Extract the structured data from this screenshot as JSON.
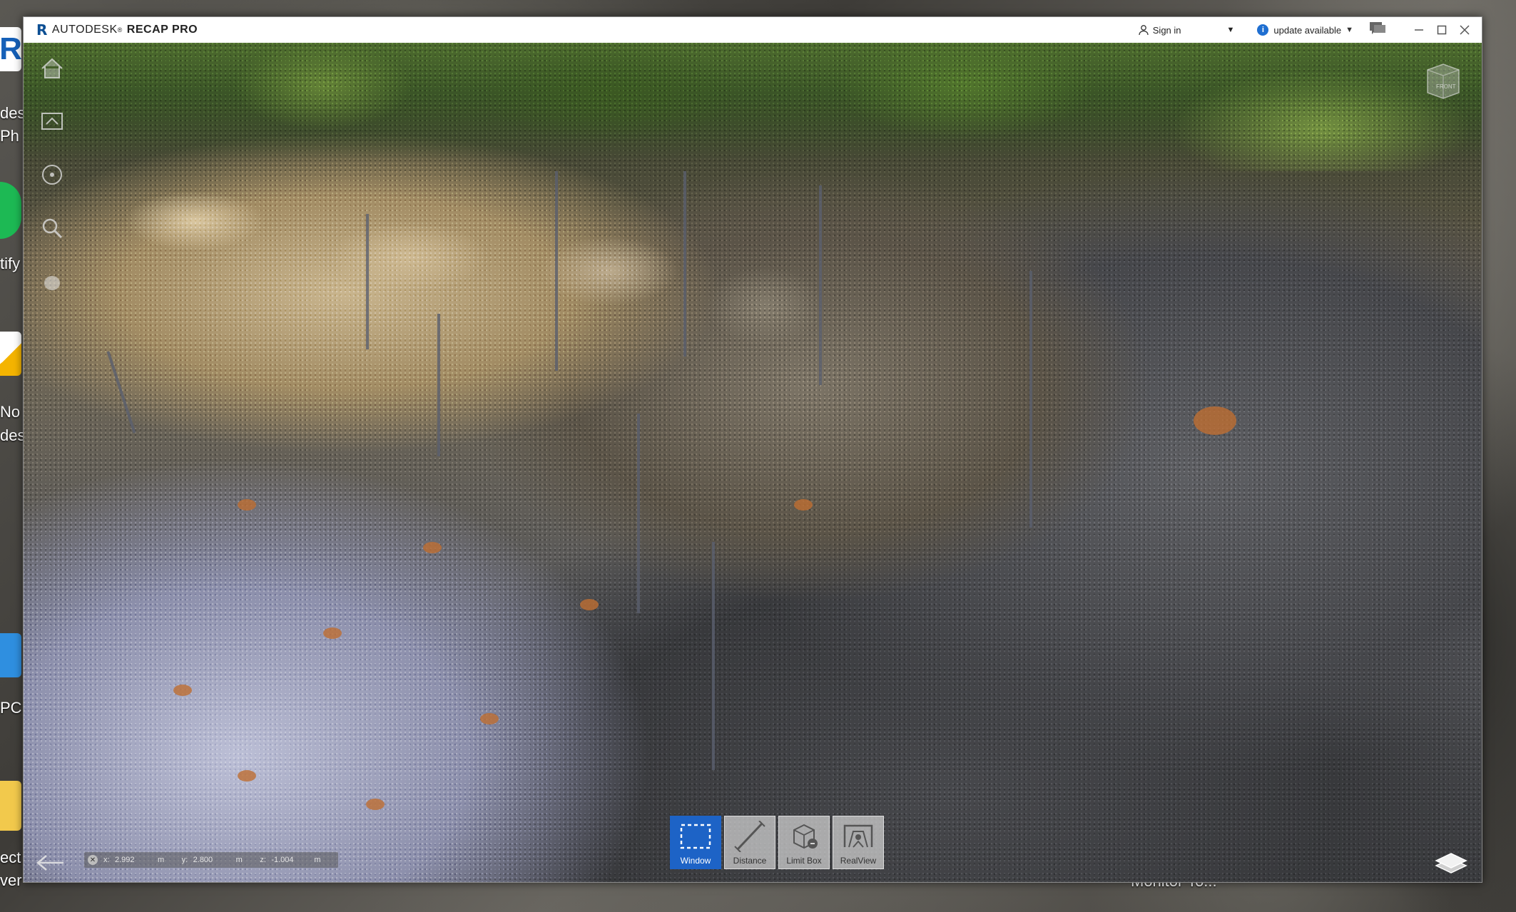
{
  "app": {
    "brand": "AUTODESK",
    "trademark": "®",
    "product": "RECAP PRO",
    "logo_letter": "R"
  },
  "titlebar": {
    "sign_in_label": "Sign in",
    "update_label": "update available",
    "info_glyph": "i"
  },
  "viewcube": {
    "face_label": "FRONT"
  },
  "coordinates": {
    "x_label": "x:",
    "x_value": "2.992",
    "x_unit": "m",
    "y_label": "y:",
    "y_value": "2.800",
    "y_unit": "m",
    "z_label": "z:",
    "z_value": "-1.004",
    "z_unit": "m"
  },
  "toolbar": {
    "window_label": "Window",
    "distance_label": "Distance",
    "limit_box_label": "Limit Box",
    "realview_label": "RealView",
    "active_tool": "Window"
  },
  "desktop": {
    "icon_labels": [
      "des",
      "Ph",
      "tify",
      "No",
      "des",
      "PC",
      "ect",
      "ver"
    ],
    "taskbar_text": "Monitor To..."
  },
  "colors": {
    "accent": "#1d63c6",
    "info": "#1f6fd1",
    "logo": "#0d4f93"
  },
  "icons": {
    "home": "home-icon",
    "zoom_extents": "frame-icon",
    "orbit": "orbit-icon",
    "zoom": "zoom-icon",
    "pan": "pan-icon",
    "layers": "layers-icon",
    "back": "back-arrow-icon"
  }
}
